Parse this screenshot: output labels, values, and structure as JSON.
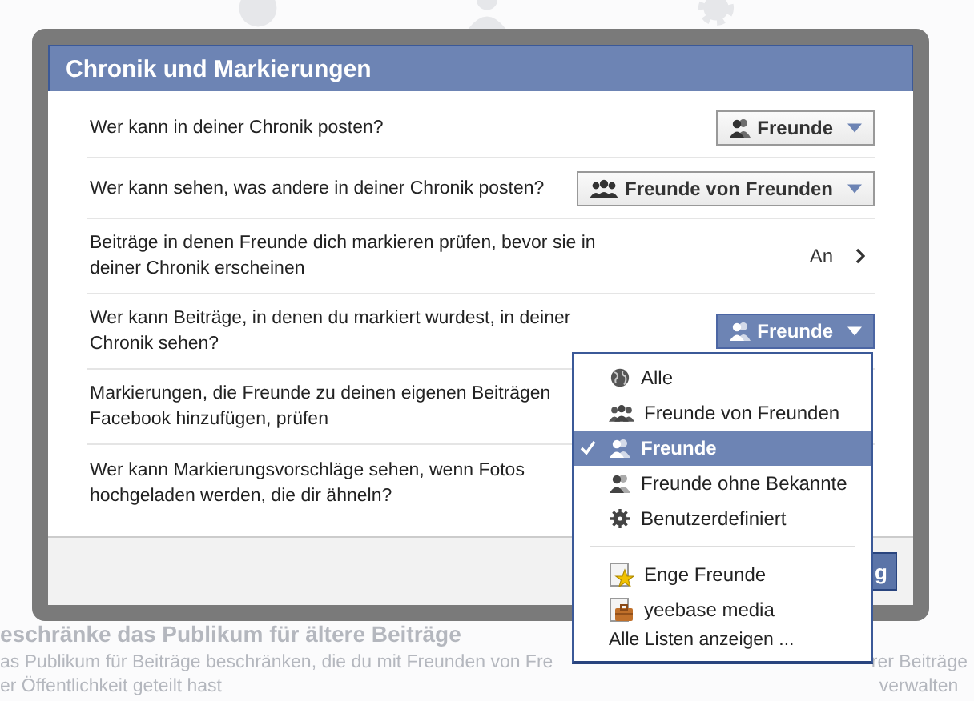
{
  "background": {
    "heading": "eschränke das Publikum für ältere Beiträge",
    "description_lines": [
      "as Publikum für Beiträge beschränken, die du mit Freunden von Fre",
      "er Öffentlichkeit geteilt hast"
    ],
    "side_text": "rer Beiträge",
    "link": "verwalten"
  },
  "dialog": {
    "title": "Chronik und Markierungen",
    "rows": [
      {
        "kind": "select",
        "question": "Wer kann in deiner Chronik posten?",
        "value": {
          "label": "Freunde",
          "kind": "friends"
        },
        "open": false
      },
      {
        "kind": "select",
        "question": "Wer kann sehen, was andere in deiner Chronik posten?",
        "value": {
          "label": "Freunde von Freunden",
          "kind": "friends_of_friends"
        },
        "open": false
      },
      {
        "kind": "toggle",
        "question": "Beiträge in denen Freunde dich markieren prüfen, bevor sie in deiner Chronik erscheinen",
        "value": "An"
      },
      {
        "kind": "select",
        "question": "Wer kann Beiträge, in denen du markiert wurdest, in deiner Chronik sehen?",
        "value": {
          "label": "Freunde",
          "kind": "friends"
        },
        "open": true
      },
      {
        "kind": "text",
        "question": "Markierungen, die Freunde zu deinen eigenen Beiträgen Facebook hinzufügen, prüfen"
      },
      {
        "kind": "text",
        "question": "Wer kann Markierungsvorschläge sehen, wenn Fotos hochgeladen werden, die dir ähneln?"
      }
    ],
    "footer_button": "g"
  },
  "menu": {
    "options": [
      {
        "label": "Alle",
        "kind": "public",
        "selected": false
      },
      {
        "label": "Freunde von Freunden",
        "kind": "friends_of_friends",
        "selected": false
      },
      {
        "label": "Freunde",
        "kind": "friends",
        "selected": true
      },
      {
        "label": "Freunde ohne Bekannte",
        "kind": "acquaintances",
        "selected": false
      },
      {
        "label": "Benutzerdefiniert",
        "kind": "custom",
        "selected": false
      }
    ],
    "lists": [
      {
        "label": "Enge Freunde",
        "kind": "star_list"
      },
      {
        "label": "yeebase media",
        "kind": "work_list"
      }
    ],
    "all_lists_link": "Alle Listen anzeigen ..."
  }
}
